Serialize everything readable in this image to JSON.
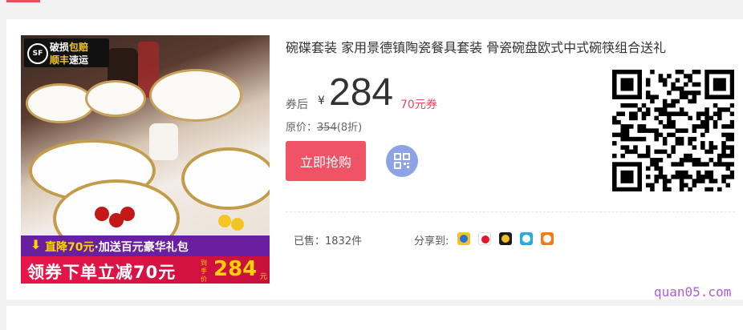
{
  "product": {
    "title": "碗碟套装 家用景德镇陶瓷餐具套装 骨瓷碗盘欧式中式碗筷组合送礼",
    "coupon_price_label": "券后",
    "currency": "¥",
    "price": "284",
    "coupon": "70元券",
    "original_price_label": "原价：",
    "original_price": "354",
    "discount": "(8折)",
    "buy_button_label": "立即抢购",
    "sold": "已售：1832件",
    "share_label": "分享到:"
  },
  "image_overlay": {
    "sf_logo": "SF",
    "sf_line1_a": "破损",
    "sf_line1_b": "包赔",
    "sf_line2_a": "顺丰",
    "sf_line2_b": "速运",
    "banner1_a": "直降70元",
    "banner1_b": "·加送百元豪华礼包",
    "banner2_text": "领券下单立减70元",
    "banner2_deal_label": "到手价",
    "banner2_price": "284",
    "banner2_unit": "元"
  },
  "share_icons": [
    "qzone-icon",
    "weibo-icon",
    "qq-icon",
    "kaixin-icon",
    "renren-icon"
  ],
  "colors": {
    "accent": "#f05365",
    "coupon": "#e84a5f",
    "qr_button": "#8ea2e6",
    "watermark": "#b05ad8"
  },
  "watermark": "quan05.com"
}
